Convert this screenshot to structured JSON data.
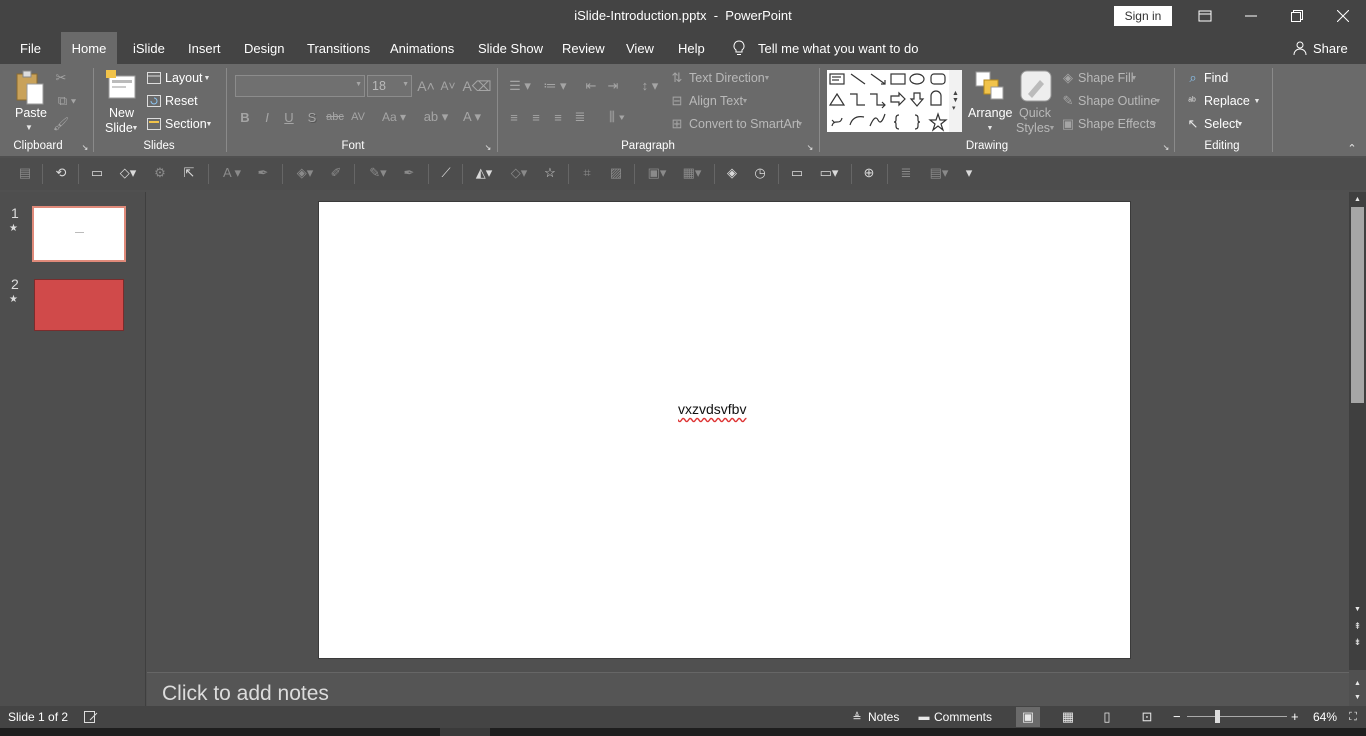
{
  "window": {
    "title": "iSlide-Introduction.pptx  -  PowerPoint",
    "sign_in": "Sign in",
    "minimize_icon": "minimize-icon",
    "restore_icon": "restore-icon",
    "close_icon": "close-icon",
    "ribbon_display_icon": "ribbon-display-options-icon"
  },
  "tabs": [
    "File",
    "Home",
    "iSlide",
    "Insert",
    "Design",
    "Transitions",
    "Animations",
    "Slide Show",
    "Review",
    "View",
    "Help"
  ],
  "active_tab": "Home",
  "tell_me": "Tell me what you want to do",
  "share": "Share",
  "ribbon": {
    "clipboard": {
      "label": "Clipboard",
      "paste": "Paste"
    },
    "slides": {
      "label": "Slides",
      "new_slide_line1": "New",
      "new_slide_line2": "Slide",
      "layout": "Layout",
      "reset": "Reset",
      "section": "Section"
    },
    "font": {
      "label": "Font",
      "font_name": "",
      "font_size": "18",
      "bold": "B",
      "italic": "I",
      "underline": "U",
      "shadow": "S",
      "strike": "abc",
      "spacing": "AV"
    },
    "paragraph": {
      "label": "Paragraph",
      "text_direction": "Text Direction",
      "align_text": "Align Text",
      "convert_smartart": "Convert to SmartArt"
    },
    "drawing": {
      "label": "Drawing",
      "arrange": "Arrange",
      "quick_styles_line1": "Quick",
      "quick_styles_line2": "Styles",
      "shape_fill": "Shape Fill",
      "shape_outline": "Shape Outline",
      "shape_effects": "Shape Effects"
    },
    "editing": {
      "label": "Editing",
      "find": "Find",
      "replace": "Replace",
      "select": "Select"
    }
  },
  "slides_pane": {
    "slides": [
      {
        "number": "1",
        "star": "★",
        "fill": "#ffffff",
        "selected": true
      },
      {
        "number": "2",
        "star": "★",
        "fill": "#d04a4a",
        "selected": false
      }
    ]
  },
  "slide": {
    "text": "vxzvdsvfbv"
  },
  "notes": {
    "placeholder": "Click to add notes"
  },
  "status": {
    "slide_info": "Slide 1 of 2",
    "notes": "Notes",
    "comments": "Comments",
    "zoom": "64%",
    "zoom_minus": "−",
    "zoom_plus": "+"
  }
}
